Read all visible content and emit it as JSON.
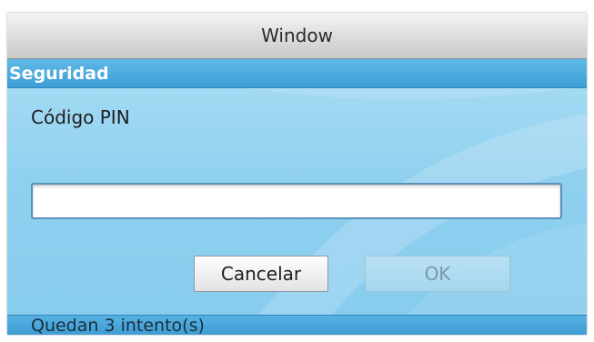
{
  "window": {
    "title": "Window"
  },
  "dialog": {
    "header": "Seguridad",
    "pin_label": "Código PIN",
    "pin_value": "",
    "pin_placeholder": "",
    "cancel_label": "Cancelar",
    "ok_label": "OK",
    "status_text": "Quedan 3 intento(s)"
  },
  "colors": {
    "accent": "#3d9fd6",
    "background": "#8fd0ef"
  }
}
